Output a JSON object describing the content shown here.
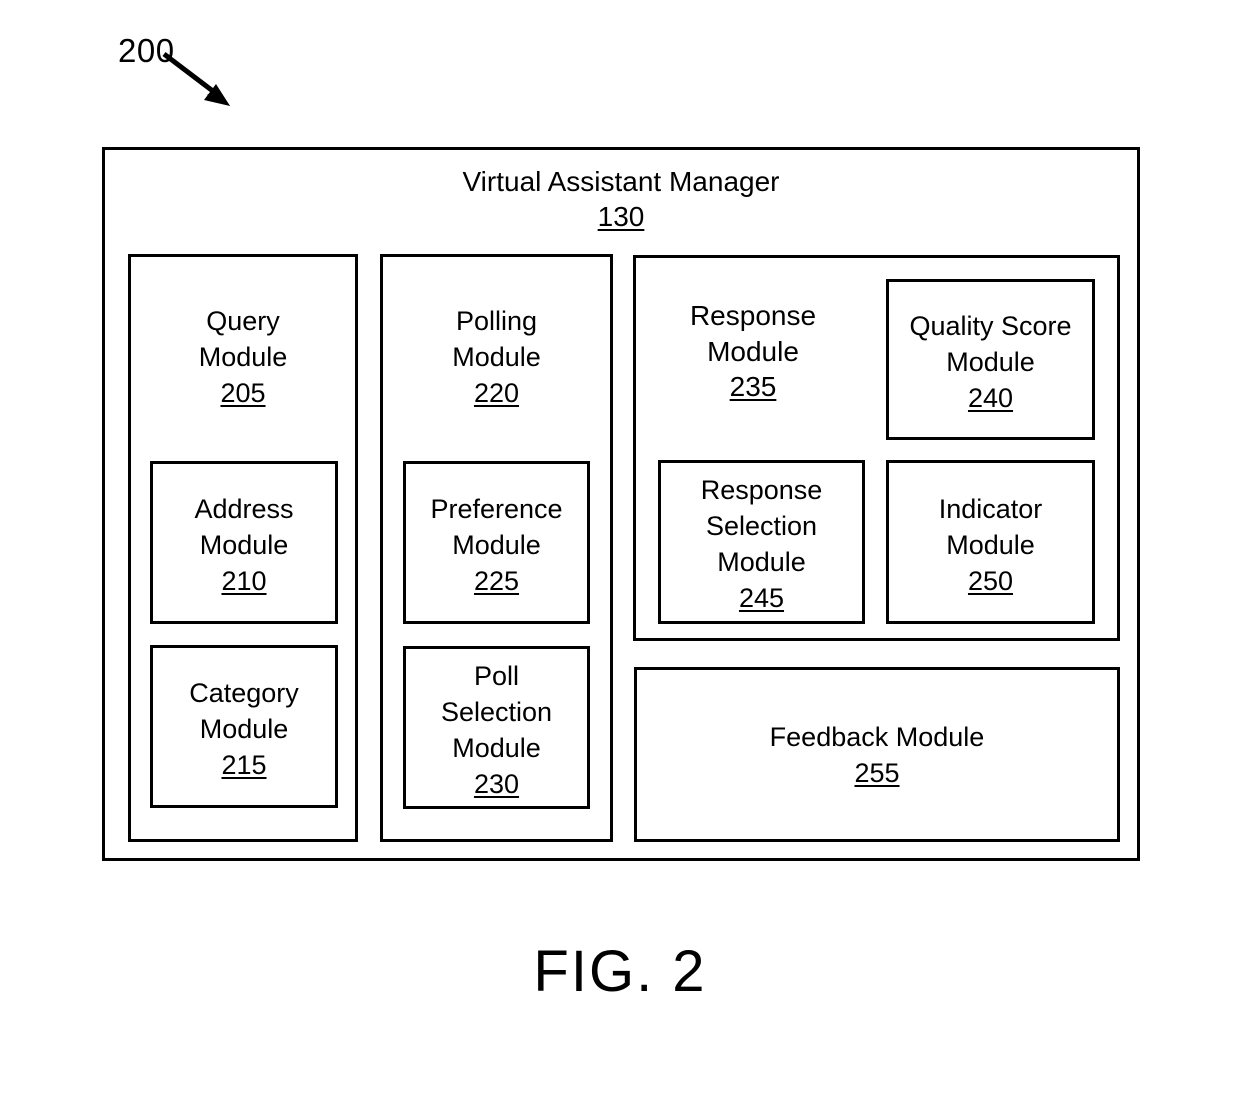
{
  "figure": {
    "reference_label": "200",
    "caption": "FIG. 2",
    "arrow_icon": "diagonal-arrow-down-right"
  },
  "manager": {
    "title": "Virtual Assistant Manager",
    "ref": "130"
  },
  "columns": [
    {
      "id": "query",
      "header": {
        "line1": "Query",
        "line2": "Module",
        "ref": "205"
      },
      "modules": [
        {
          "id": "address",
          "line1": "Address",
          "line2": "Module",
          "ref": "210"
        },
        {
          "id": "category",
          "line1": "Category",
          "line2": "Module",
          "ref": "215"
        }
      ]
    },
    {
      "id": "polling",
      "header": {
        "line1": "Polling",
        "line2": "Module",
        "ref": "220"
      },
      "modules": [
        {
          "id": "preference",
          "line1": "Preference",
          "line2": "Module",
          "ref": "225"
        },
        {
          "id": "poll_selection",
          "line1": "Poll",
          "line2": "Selection",
          "line3": "Module",
          "ref": "230"
        }
      ]
    }
  ],
  "response_group": {
    "header": {
      "line1": "Response",
      "line2": "Module",
      "ref": "235"
    },
    "modules": [
      {
        "id": "quality_score",
        "line1": "Quality Score",
        "line2": "Module",
        "ref": "240"
      },
      {
        "id": "response_selection",
        "line1": "Response",
        "line2": "Selection",
        "line3": "Module",
        "ref": "245"
      },
      {
        "id": "indicator",
        "line1": "Indicator",
        "line2": "Module",
        "ref": "250"
      }
    ]
  },
  "feedback": {
    "line1": "Feedback Module",
    "ref": "255"
  },
  "colors": {
    "stroke": "#000000",
    "background": "#ffffff",
    "text": "#000000"
  }
}
